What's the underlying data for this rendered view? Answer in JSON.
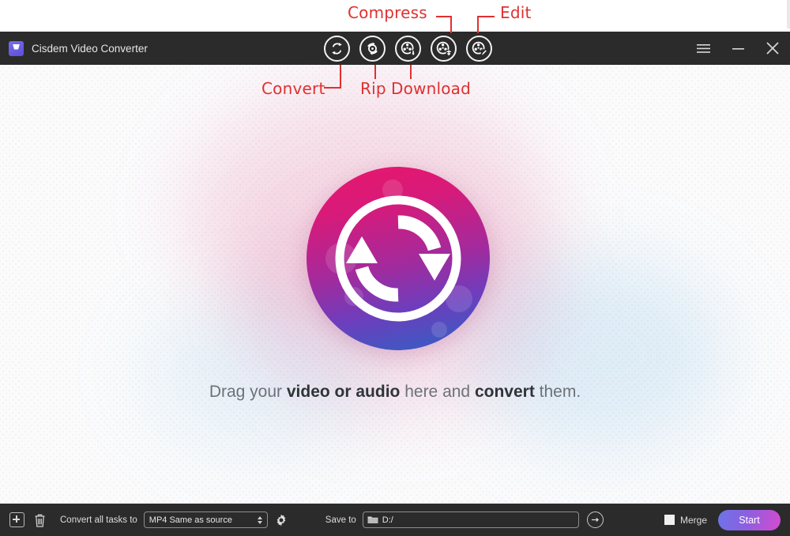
{
  "window": {
    "title": "Cisdem Video Converter",
    "logo_icon": "cisdem-logo-icon",
    "controls": {
      "menu_label": "☰",
      "minimize_label": "−",
      "close_label": "✕"
    }
  },
  "toolbar": {
    "items": [
      {
        "name": "convert",
        "icon": "convert-circular-arrows-icon",
        "tooltip": "Convert"
      },
      {
        "name": "rip",
        "icon": "rip-disc-arrows-icon",
        "tooltip": "Rip"
      },
      {
        "name": "download",
        "icon": "download-film-reel-icon",
        "tooltip": "Download"
      },
      {
        "name": "compress",
        "icon": "compress-film-reel-icon",
        "tooltip": "Compress"
      },
      {
        "name": "edit",
        "icon": "edit-film-reel-icon",
        "tooltip": "Edit"
      }
    ]
  },
  "annotations": {
    "color": "#e03030",
    "labels": [
      {
        "text": "Compress",
        "target": "compress"
      },
      {
        "text": "Edit",
        "target": "edit"
      },
      {
        "text": "Convert",
        "target": "convert"
      },
      {
        "text": "Rip",
        "target": "rip"
      },
      {
        "text": "Download",
        "target": "download"
      }
    ]
  },
  "main": {
    "logo_icon": "convert-circular-arrows-logo",
    "drop_text": {
      "part1": "Drag your ",
      "bold1": "video or audio",
      "part2": " here and ",
      "bold2": "convert",
      "part3": " them."
    }
  },
  "bottom": {
    "add_button_icon": "plus-icon",
    "delete_button_icon": "trash-icon",
    "convert_all_label": "Convert all tasks to",
    "format_select": {
      "value": "MP4 Same as source"
    },
    "settings_icon": "gear-icon",
    "save_to_label": "Save to",
    "save_path": {
      "value": "D:/",
      "placeholder": "D:/",
      "folder_icon": "folder-icon"
    },
    "open_folder_icon": "arrow-right-icon",
    "merge": {
      "label": "Merge",
      "checked": false
    },
    "start_label": "Start"
  },
  "colors": {
    "chrome": "#2b2b2b",
    "canvas": "#fbfbfc",
    "accent_pink": "#e8176c",
    "accent_blue": "#2c63c4",
    "annotation_red": "#e03030",
    "start_gradient_from": "#6d74e8",
    "start_gradient_to": "#d44bd0"
  }
}
